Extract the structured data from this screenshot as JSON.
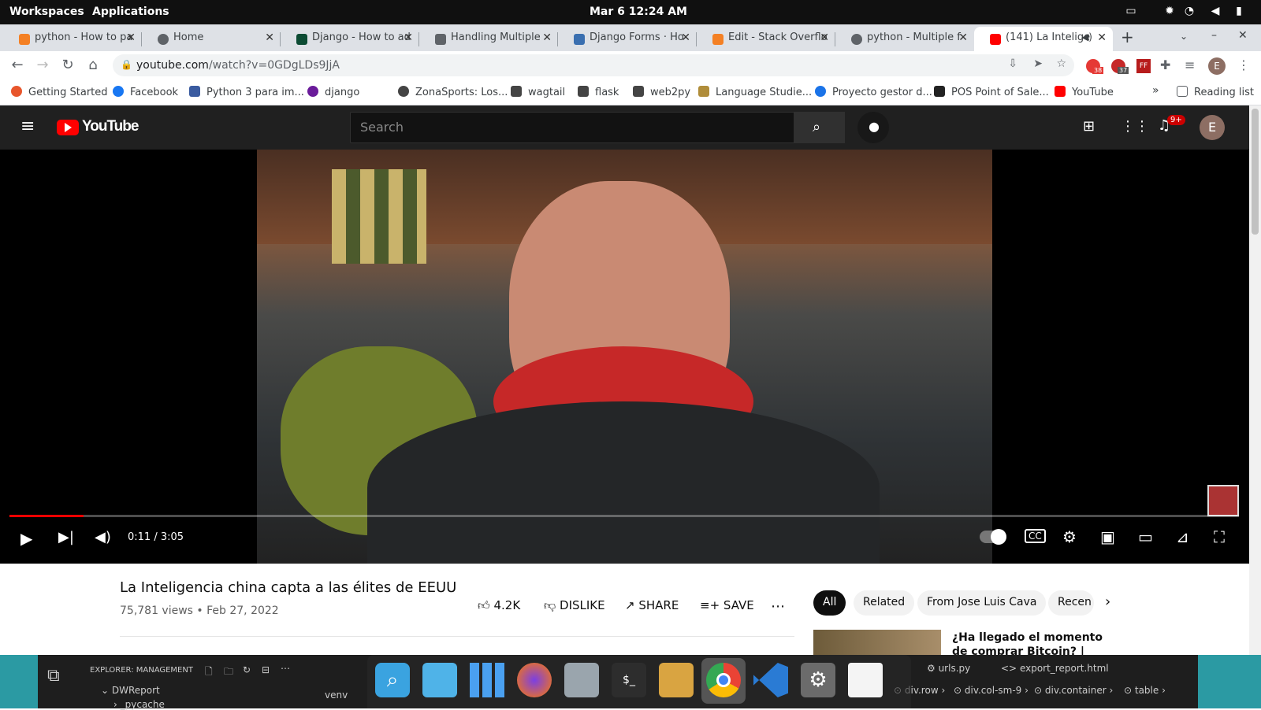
{
  "topbar": {
    "workspaces": "Workspaces",
    "applications": "Applications",
    "clock": "Mar 6  12:24 AM"
  },
  "tabs": [
    {
      "title": "python - How to pa",
      "color": "#f48024"
    },
    {
      "title": "Home",
      "color": "#5f6368"
    },
    {
      "title": "Django - How to ad",
      "color": "#0c4b33"
    },
    {
      "title": "Handling Multiple",
      "color": "#5f6368"
    },
    {
      "title": "Django Forms · Ho",
      "color": "#3a6fb0"
    },
    {
      "title": "Edit - Stack Overflo",
      "color": "#f48024"
    },
    {
      "title": "python - Multiple f",
      "color": "#5f6368"
    },
    {
      "title": "(141) La Intelige",
      "color": "#ff0000"
    }
  ],
  "address": {
    "host": "youtube.com",
    "path": "/watch?v=0GDgLDs9JjA"
  },
  "bookmarks": [
    {
      "label": "Getting Started",
      "color": "#e8562c"
    },
    {
      "label": "Facebook",
      "color": "#1877f2"
    },
    {
      "label": "Python 3 para im...",
      "color": "#3a5ba0"
    },
    {
      "label": "django",
      "color": "#6a1b9a"
    },
    {
      "label": "ZonaSports: Los...",
      "color": "#444"
    },
    {
      "label": "wagtail",
      "color": "#444"
    },
    {
      "label": "flask",
      "color": "#444"
    },
    {
      "label": "web2py",
      "color": "#444"
    },
    {
      "label": "Language Studie...",
      "color": "#b08d3a"
    },
    {
      "label": "Proyecto gestor d...",
      "color": "#1a73e8"
    },
    {
      "label": "POS Point of Sale...",
      "color": "#222"
    },
    {
      "label": "YouTube",
      "color": "#ff0000"
    }
  ],
  "reading_list": "Reading list",
  "youtube": {
    "logo": "YouTube",
    "search_placeholder": "Search",
    "notif_badge": "9+",
    "avatar": "E"
  },
  "video": {
    "title": "La Inteligencia china capta a las élites de EEUU",
    "views": "75,781 views • Feb 27, 2022",
    "time": "0:11 / 3:05",
    "progress": 0.06,
    "likes": "4.2K",
    "dislike": "DISLIKE",
    "share": "SHARE",
    "save": "SAVE"
  },
  "chips": [
    "All",
    "Related",
    "From Jose Luis Cava",
    "Recen"
  ],
  "related": {
    "title": "¿Ha llegado el momento de comprar Bitcoin? | José Luis"
  },
  "vscode": {
    "explorer": "EXPLORER: MANAGEMENT",
    "folder": "DWReport",
    "sub": "_pycache",
    "venv": "venv",
    "tab1": "urls.py",
    "tab2": "export_report.html",
    "crumbs": [
      "div.row",
      "div.col-sm-9",
      "div.container",
      "table"
    ]
  },
  "ext_badges": [
    "38",
    "37"
  ]
}
